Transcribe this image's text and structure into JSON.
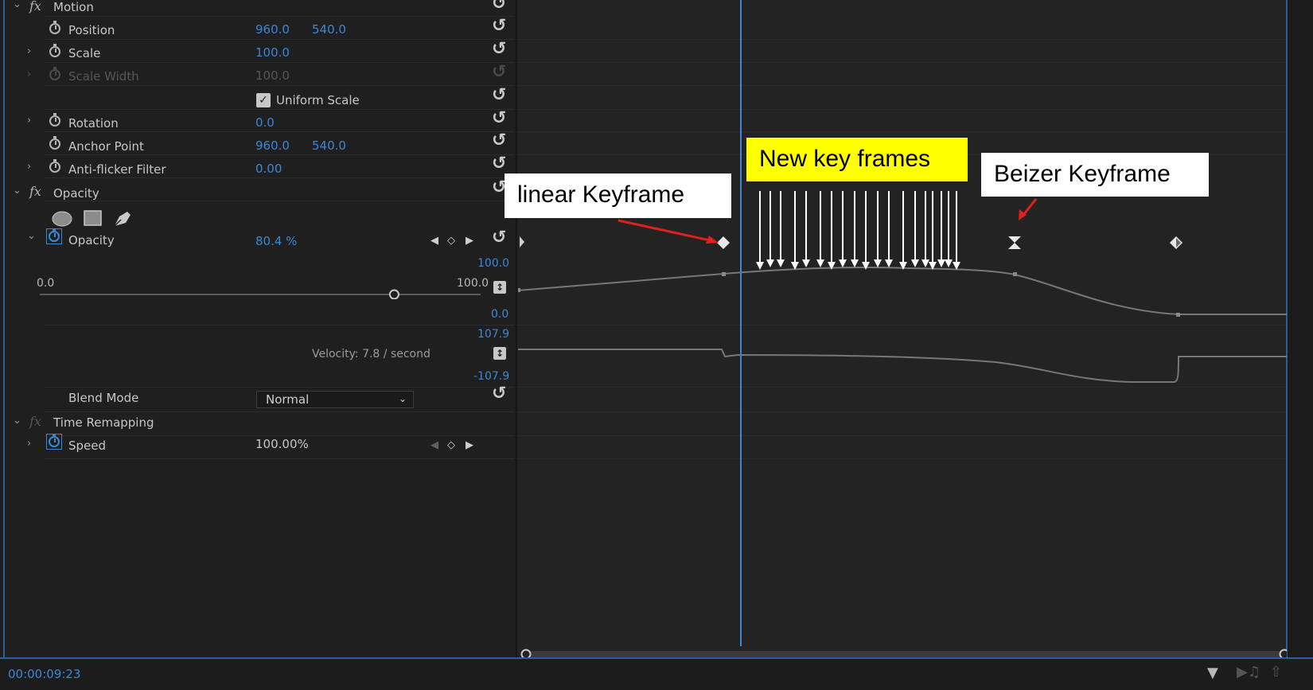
{
  "sections": {
    "motion": {
      "label": "Motion"
    },
    "opacity_section": {
      "label": "Opacity"
    },
    "time_remapping": {
      "label": "Time Remapping"
    }
  },
  "properties": {
    "position": {
      "label": "Position",
      "x": "960.0",
      "y": "540.0"
    },
    "scale": {
      "label": "Scale",
      "value": "100.0"
    },
    "scale_width": {
      "label": "Scale Width",
      "value": "100.0"
    },
    "uniform_scale": {
      "label": "Uniform Scale",
      "checked": true
    },
    "rotation": {
      "label": "Rotation",
      "value": "0.0"
    },
    "anchor_point": {
      "label": "Anchor Point",
      "x": "960.0",
      "y": "540.0"
    },
    "anti_flicker": {
      "label": "Anti-flicker Filter",
      "value": "0.00"
    },
    "opacity": {
      "label": "Opacity",
      "value": "80.4 %"
    },
    "blend_mode": {
      "label": "Blend Mode",
      "value": "Normal"
    },
    "speed": {
      "label": "Speed",
      "value": "100.00%"
    }
  },
  "opacity_graph": {
    "slider_min": "0.0",
    "slider_max": "100.0",
    "slider_value": 80.4,
    "value_top": "100.0",
    "value_bottom": "0.0",
    "velocity_top": "107.9",
    "velocity_bottom": "-107.9",
    "velocity_text": "Velocity: 7.8 / second"
  },
  "annotations": {
    "linear": "linear Keyframe",
    "new": "New key frames",
    "bezier": "Beizer Keyframe"
  },
  "status": {
    "timecode": "00:00:09:23"
  },
  "icons": {
    "reset": "reset-parameter-icon",
    "stopwatch": "toggle-animation-icon",
    "ellipse_mask": "ellipse-mask-icon",
    "rect_mask": "rectangle-mask-icon",
    "pen_mask": "pen-mask-icon",
    "filter": "filter-icon",
    "play_audio": "play-audio-icon",
    "export": "export-icon"
  },
  "colors": {
    "accent": "#3b87d6",
    "callout_yellow": "#ffff00",
    "arrow_red": "#e0201e"
  }
}
